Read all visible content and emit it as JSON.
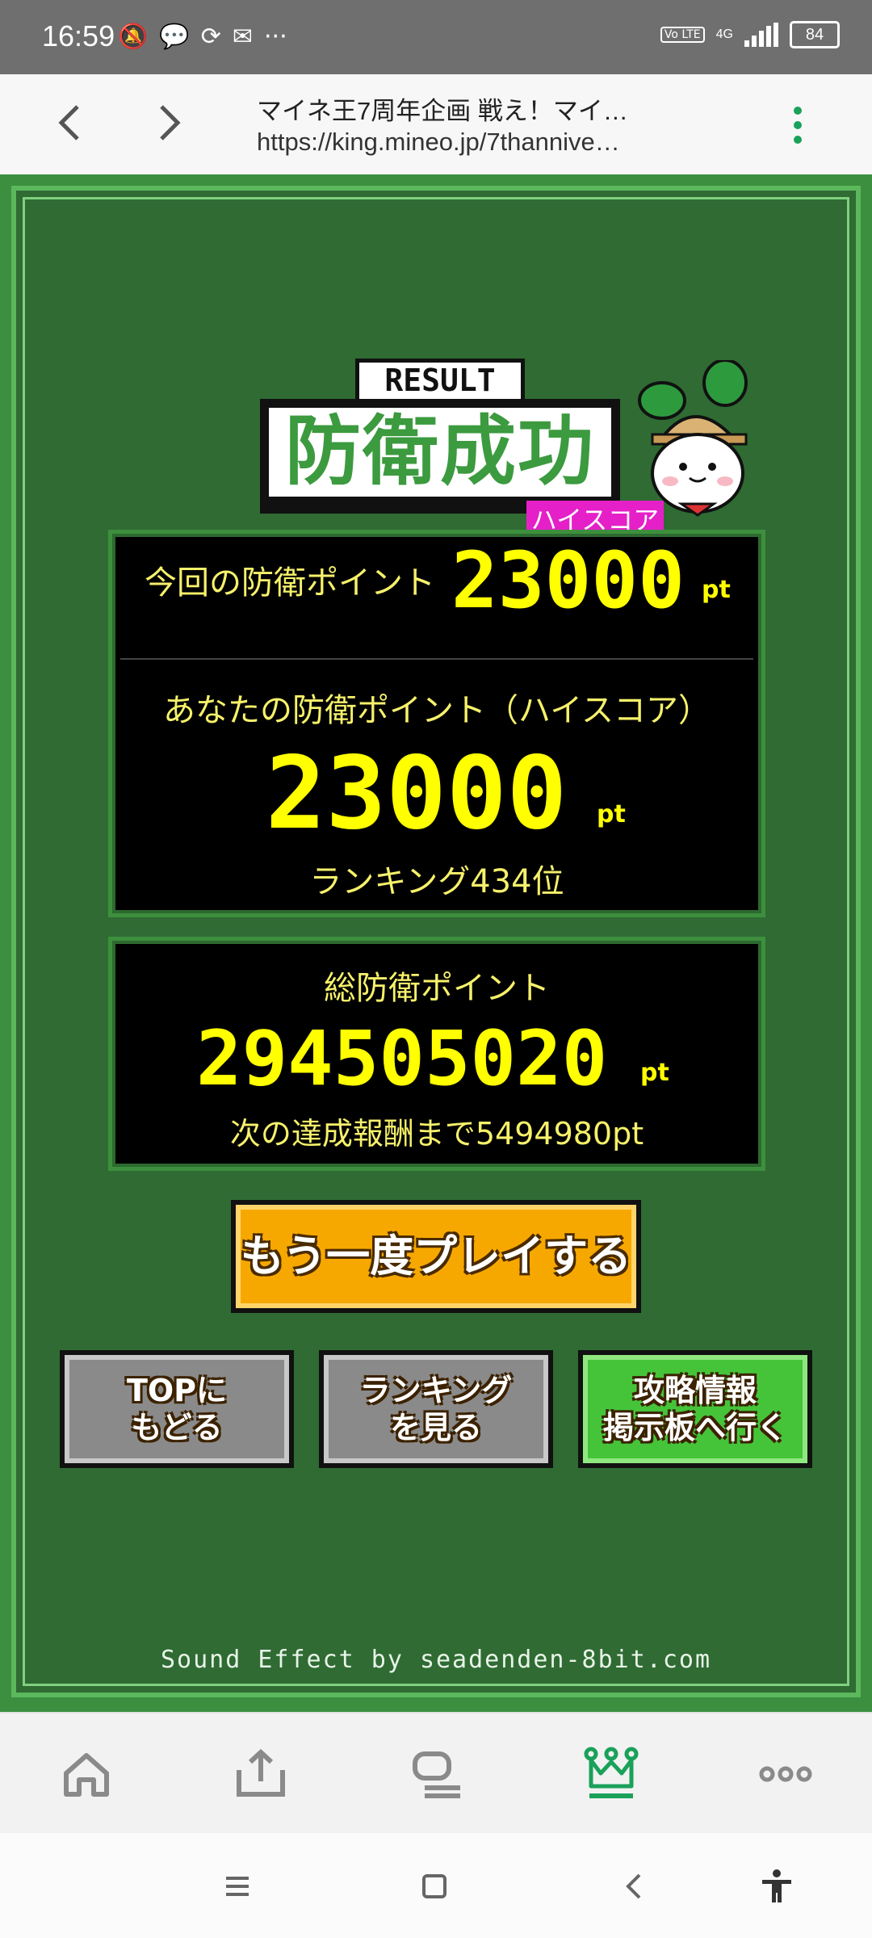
{
  "status_bar": {
    "time": "16:59",
    "battery": "84",
    "network": "4G",
    "volte": "Vo LTE",
    "more": "···"
  },
  "browser": {
    "title": "マイネ王7周年企画 戦え！マイ…",
    "url": "https://king.mineo.jp/7thannive…"
  },
  "game": {
    "result_label": "RESULT",
    "result_title": "防衛成功",
    "highscore_badge": "ハイスコア",
    "current_label": "今回の防衛ポイント",
    "current_points": "23000",
    "pt_unit": "pt",
    "highscore_label": "あなたの防衛ポイント（ハイスコア）",
    "highscore_points": "23000",
    "ranking": "ランキング434位",
    "total_label": "総防衛ポイント",
    "total_points": "294505020",
    "next_reward": "次の達成報酬まで5494980pt",
    "play_again": "もう一度プレイする",
    "btn_top": "TOPに\nもどる",
    "btn_ranking": "ランキング\nを見る",
    "btn_info": "攻略情報\n掲示板へ行く",
    "credit": "Sound Effect by seadenden-8bit.com"
  },
  "colors": {
    "accent_green": "#1aa15a",
    "game_bg": "#2f6b33",
    "score_yellow": "#ffff00",
    "badge_pink": "#e520c8",
    "button_orange": "#f7a800"
  }
}
